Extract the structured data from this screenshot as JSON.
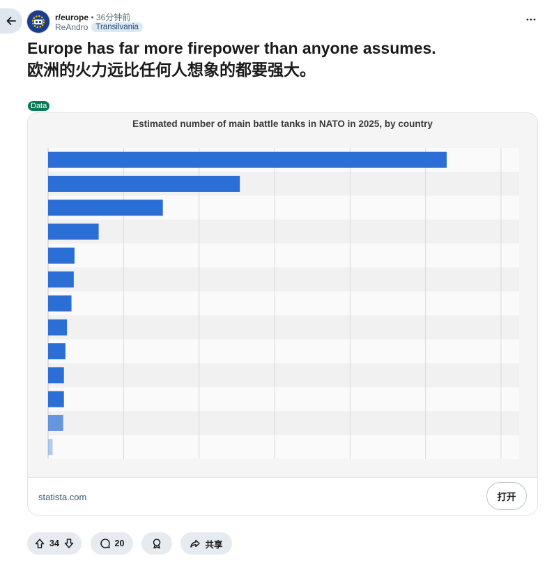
{
  "post": {
    "subreddit": "r/europe",
    "separator": "•",
    "time": "36分钟前",
    "author": "ReAndro",
    "author_flair": "Transilvania",
    "title_line1": "Europe has far more firepower than anyone assumes.",
    "title_line2": "欧洲的火力远比任何人想象的都要强大。",
    "post_flair": "Data",
    "flair_color": "#0a7a58"
  },
  "link_card": {
    "domain": "statista.com",
    "open_label": "打开"
  },
  "chart_data": {
    "type": "bar",
    "orientation": "horizontal",
    "title": "Estimated number of main battle tanks in NATO in 2025, by country",
    "categories": [],
    "values": [
      2640,
      1270,
      760,
      335,
      175,
      170,
      155,
      125,
      115,
      105,
      105,
      100,
      30
    ],
    "xlim": [
      0,
      3120
    ],
    "grid": true,
    "bar_color": "#2b6fd6"
  },
  "actions": {
    "upvotes": "34",
    "comments": "20",
    "share_label": "共享"
  },
  "colors": {
    "accent": "#0a7a58",
    "button_bg": "#e5ebee",
    "bar": "#2b6fd6"
  }
}
